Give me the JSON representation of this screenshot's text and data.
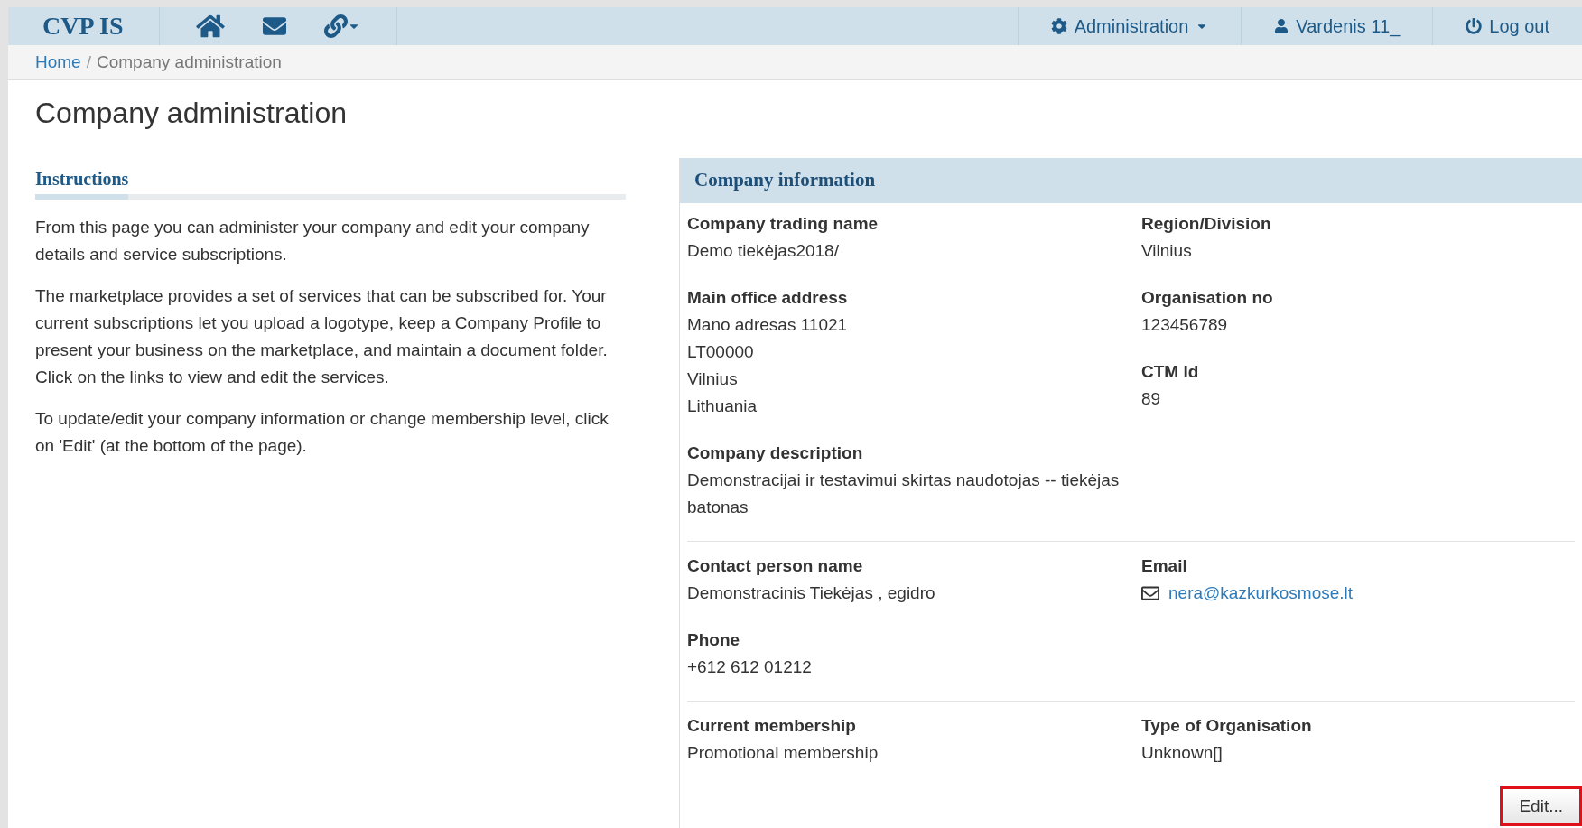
{
  "navbar": {
    "brand": "CVP IS",
    "menus": [
      {
        "kind": "admin",
        "label": "Administration"
      },
      {
        "kind": "user",
        "label": "Vardenis 11_"
      },
      {
        "kind": "logout",
        "label": "Log out"
      }
    ]
  },
  "breadcrumb": {
    "items": [
      "Home"
    ],
    "separator": "/",
    "current": "Company administration"
  },
  "page_title": "Company administration",
  "instructions": {
    "title": "Instructions",
    "paragraphs": [
      "From this page you can administer your company and edit your company details and service subscriptions.",
      "The marketplace provides a set of services that can be subscribed for. Your current subscriptions let you upload a logotype, keep a Company Profile to present your business on the marketplace, and maintain a document folder. Click on the links to view and edit the services.",
      "To update/edit your company information or change membership level, click on 'Edit' (at the bottom of the page)."
    ]
  },
  "company_info": {
    "title": "Company information",
    "sections": [
      {
        "rows": [
          {
            "cells": [
              [
                {
                  "label": "Company trading name",
                  "lines": [
                    "Demo tiekėjas2018/"
                  ]
                }
              ],
              [
                {
                  "label": "Region/Division",
                  "lines": [
                    "Vilnius"
                  ]
                }
              ]
            ]
          },
          {
            "cells": [
              [
                {
                  "label": "Main office address",
                  "lines": [
                    "Mano adresas 11021",
                    "LT00000",
                    "Vilnius",
                    "Lithuania"
                  ]
                }
              ],
              [
                {
                  "label": "Organisation no",
                  "lines": [
                    "123456789"
                  ]
                },
                {
                  "label": "CTM Id",
                  "lines": [
                    "89"
                  ]
                }
              ]
            ]
          },
          {
            "cells": [
              [
                {
                  "label": "Company description",
                  "lines": [
                    "Demonstracijai ir testavimui skirtas naudotojas -- tiekėjas batonas"
                  ]
                }
              ]
            ]
          }
        ]
      },
      {
        "rows": [
          {
            "cells": [
              [
                {
                  "label": "Contact person name",
                  "lines": [
                    "Demonstracinis Tiekėjas , egidro"
                  ]
                },
                {
                  "label": "Phone",
                  "lines": [
                    "+612 612 01212"
                  ]
                }
              ],
              [
                {
                  "label": "Email",
                  "kind": "email",
                  "lines": [
                    "nera@kazkurkosmose.lt"
                  ]
                }
              ]
            ]
          }
        ]
      },
      {
        "rows": [
          {
            "cells": [
              [
                {
                  "label": "Current membership",
                  "lines": [
                    "Promotional membership"
                  ]
                }
              ],
              [
                {
                  "label": "Type of Organisation",
                  "lines": [
                    "Unknown[]"
                  ]
                }
              ]
            ]
          }
        ]
      }
    ],
    "edit_button": {
      "label": "Edit...",
      "highlighted": true
    }
  }
}
